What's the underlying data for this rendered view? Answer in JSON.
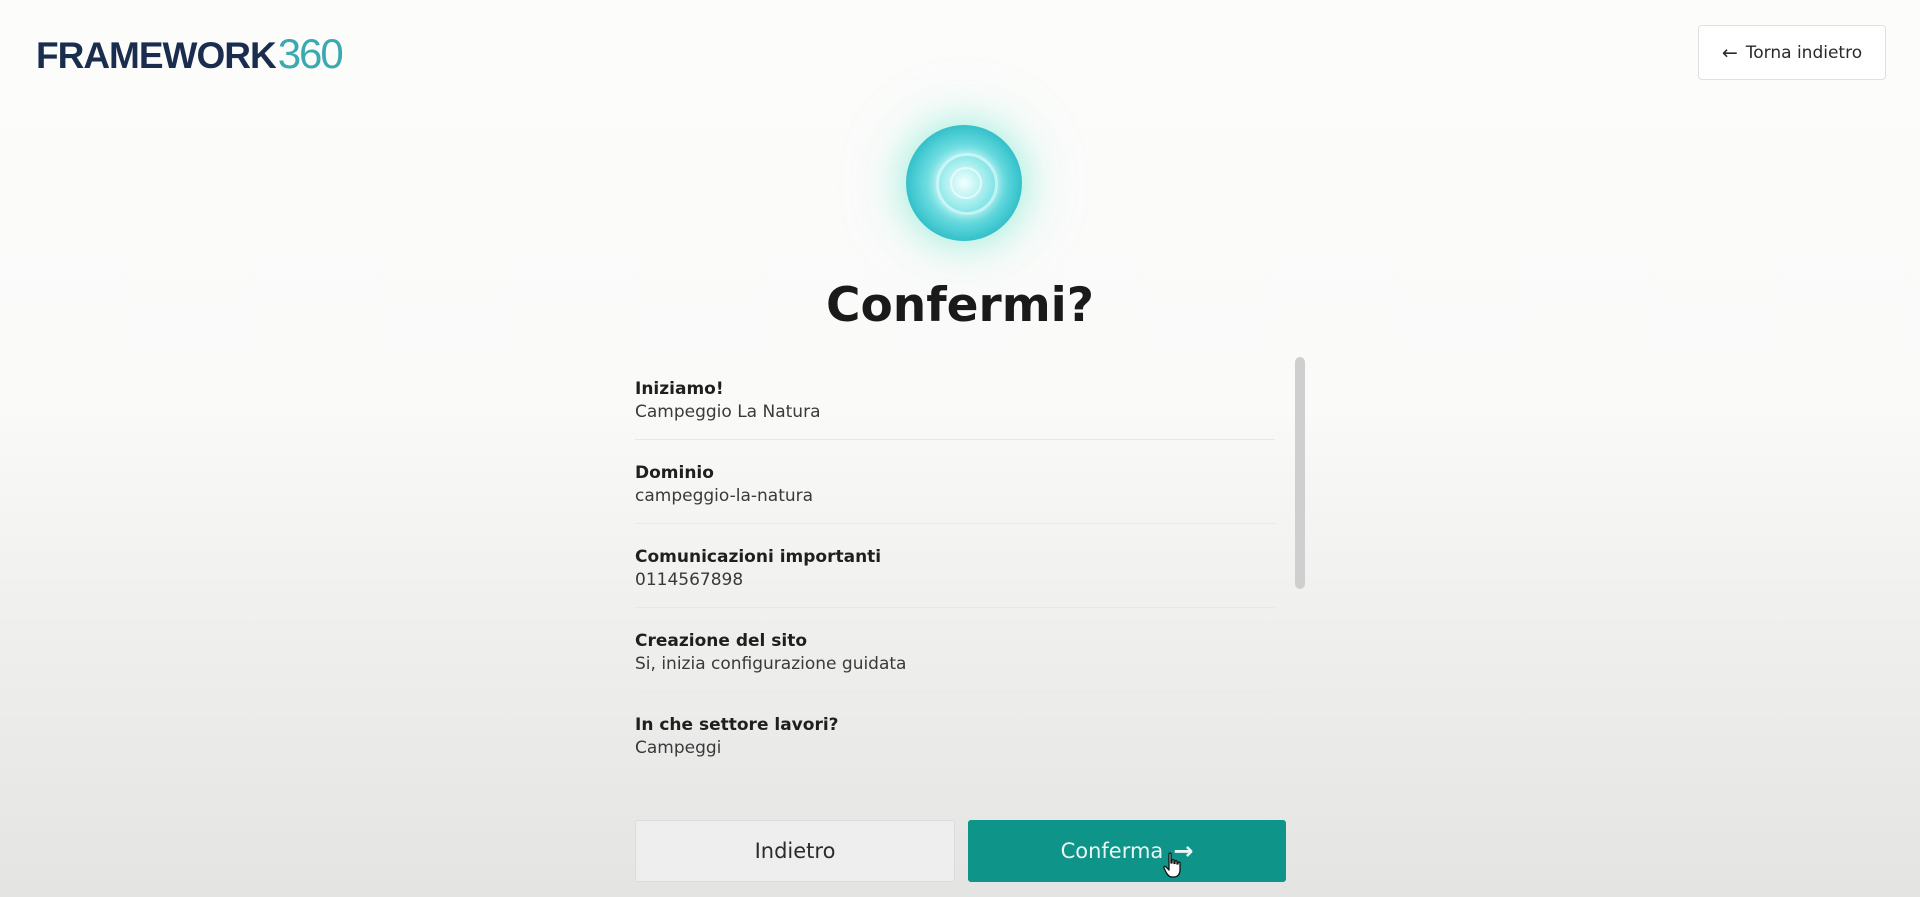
{
  "header": {
    "logo_word": "FRAMEWORK",
    "logo_number": "360",
    "back_button_label": "Torna indietro",
    "back_icon": "arrow-left-icon"
  },
  "main": {
    "orb_icon": "glowing-orb-icon",
    "title": "Confermi?",
    "summary": [
      {
        "label": "Iniziamo!",
        "value": "Campeggio La Natura"
      },
      {
        "label": "Dominio",
        "value": "campeggio-la-natura"
      },
      {
        "label": "Comunicazioni importanti",
        "value": "0114567898"
      },
      {
        "label": "Creazione del sito",
        "value": "Si, inizia configurazione guidata"
      },
      {
        "label": "In che settore lavori?",
        "value": "Campeggi"
      }
    ]
  },
  "actions": {
    "back_label": "Indietro",
    "confirm_label": "Conferma",
    "confirm_icon": "arrow-right-icon"
  },
  "colors": {
    "accent": "#0e9488",
    "logo_dark": "#1b2d4e",
    "logo_teal": "#3aaab0"
  }
}
